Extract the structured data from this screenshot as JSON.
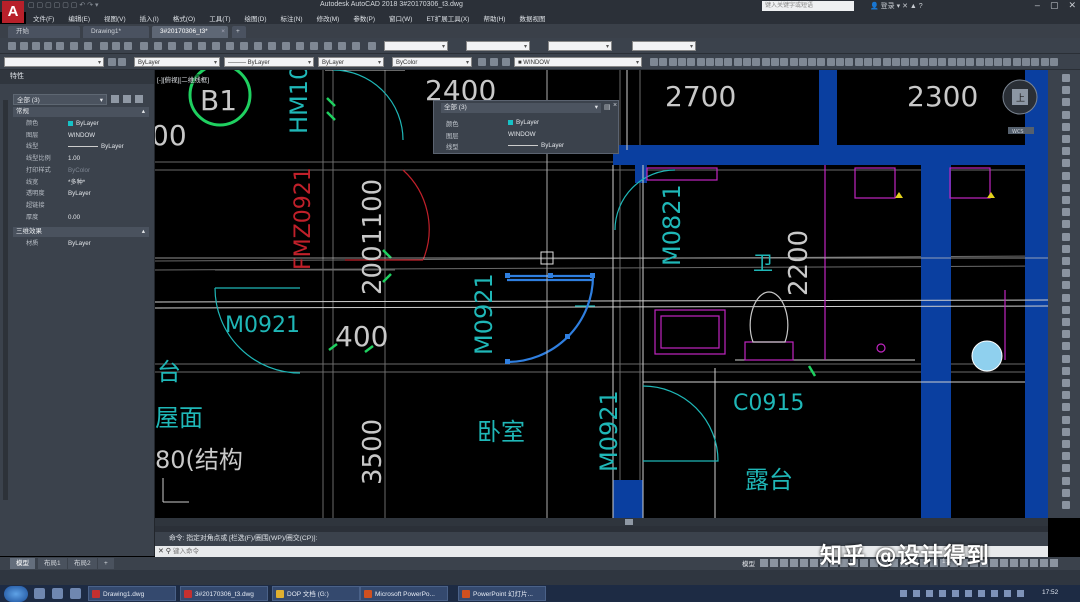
{
  "window": {
    "app_title": "Autodesk AutoCAD 2018    3#20170306_t3.dwg",
    "search_placeholder": "键入关键字或短语",
    "user": "登录",
    "logo": "A"
  },
  "menu": [
    "文件(F)",
    "编辑(E)",
    "视图(V)",
    "插入(I)",
    "格式(O)",
    "工具(T)",
    "绘图(D)",
    "标注(N)",
    "修改(M)",
    "参数(P)",
    "窗口(W)",
    "ET扩展工具(X)",
    "帮助(H)",
    "数据视图"
  ],
  "tabs": [
    {
      "label": "开始"
    },
    {
      "label": "Drawing1*"
    },
    {
      "label": "3#20170306_t3*"
    }
  ],
  "toolbar": {
    "layer_combo": "ByLayer",
    "linetype_combo": "ByLayer",
    "lineweight_combo": "ByLayer",
    "color_combo": "ByColor",
    "layer_name": "WINDOW"
  },
  "properties": {
    "title": "特性",
    "selection": "全部 (3)",
    "sections": {
      "general": "常规",
      "three_d": "三维效果"
    },
    "rows": [
      {
        "name": "颜色",
        "value": "ByLayer",
        "swatch": true
      },
      {
        "name": "图层",
        "value": "WINDOW"
      },
      {
        "name": "线型",
        "value": "ByLayer",
        "line": true
      },
      {
        "name": "线型比例",
        "value": "1.00"
      },
      {
        "name": "打印样式",
        "value": "ByColor",
        "dim": true
      },
      {
        "name": "线宽",
        "value": "*多种*"
      },
      {
        "name": "透明度",
        "value": "ByLayer"
      },
      {
        "name": "超链接",
        "value": ""
      },
      {
        "name": "厚度",
        "value": "0.00"
      }
    ],
    "rows3d": [
      {
        "name": "材质",
        "value": "ByLayer"
      }
    ]
  },
  "quick_props": {
    "selection": "全部 (3)",
    "rows": [
      {
        "name": "颜色",
        "value": "ByLayer"
      },
      {
        "name": "图层",
        "value": "WINDOW"
      },
      {
        "name": "线型",
        "value": "ByLayer"
      }
    ]
  },
  "viewport_label": "[-][俯视][二维线框]",
  "drawing_text": {
    "b1": "B1",
    "d2400": "2400",
    "d2700": "2700",
    "d2300": "2300",
    "hm": "HM10",
    "fmz": "FMZ0921",
    "d1100": "1100",
    "d200": "200",
    "d400": "400",
    "m0921a": "M0921",
    "m0921b": "M0921",
    "m0921c": "M0921",
    "m0821": "M0821",
    "d2200": "2200",
    "c0915": "C0915",
    "d3500": "3500",
    "bedroom": "卧室",
    "bath": "卫",
    "terrace": "露台",
    "roof": "屋面",
    "struct": "80(结构",
    "tai": "台",
    "d00": "00",
    "wc": "WCS",
    "compass": "上"
  },
  "command": {
    "history": "命令: 指定对角点或 [栏选(F)/圈围(WP)/圈交(CP)]:",
    "placeholder": "键入命令"
  },
  "layout_tabs": [
    "模型",
    "布局1",
    "布局2",
    "+"
  ],
  "status": {
    "model": "模型",
    "scale": "1:1"
  },
  "taskbar": {
    "items": [
      {
        "label": "Drawing1.dwg",
        "color": "#c43030"
      },
      {
        "label": "3#20170306_t3.dwg",
        "color": "#c43030"
      },
      {
        "label": "DOP 文档 (G:)",
        "color": "#e0b030"
      },
      {
        "label": "Microsoft PowerPo...",
        "color": "#d05020"
      },
      {
        "label": "PowerPoint 幻灯片...",
        "color": "#d05020"
      }
    ],
    "clock": "17:52"
  },
  "watermark": "知乎 @设计得到",
  "colors": {
    "wall_blue": "#0a3fa0",
    "cyan": "#1fb7b7",
    "green": "#1fd060",
    "red": "#c0202a",
    "magenta": "#c025c0",
    "selected": "#2f7fe0"
  }
}
